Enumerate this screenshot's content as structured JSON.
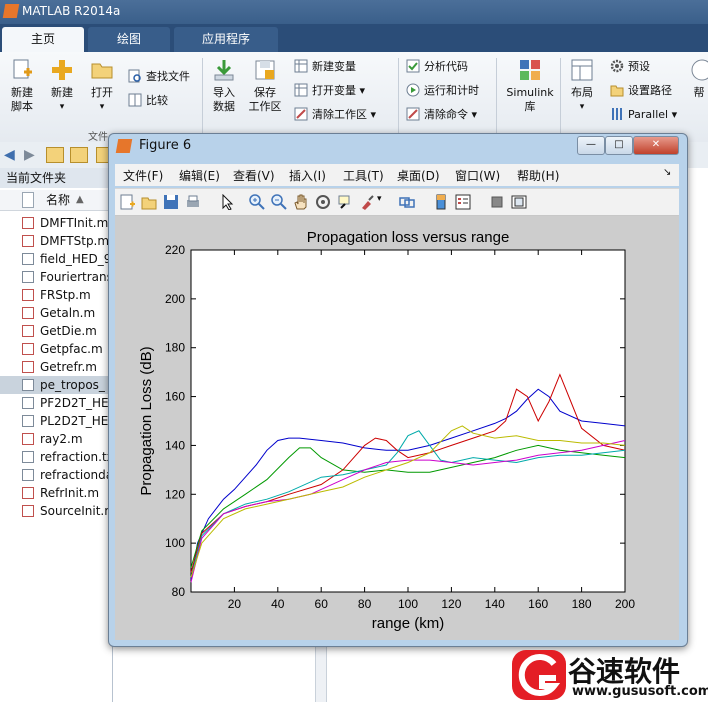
{
  "app": {
    "title": "MATLAB R2014a"
  },
  "tabs": [
    {
      "label": "主页"
    },
    {
      "label": "绘图"
    },
    {
      "label": "应用程序"
    }
  ],
  "ribbon": {
    "new_script": "新建\n脚本",
    "new": "新建",
    "open": "打开",
    "find_files": "查找文件",
    "compare": "比较",
    "import_data": "导入\n数据",
    "save_workspace": "保存\n工作区",
    "new_variable": "新建变量",
    "open_variable": "打开变量",
    "clear_workspace": "清除工作区",
    "analyze_code": "分析代码",
    "run_and_time": "运行和计时",
    "clear_commands": "清除命令",
    "simulink": "Simulink\n库",
    "layout": "布局",
    "preferences": "预设",
    "set_path": "设置路径",
    "parallel": "Parallel",
    "help": "帮",
    "file_group": "文件"
  },
  "file_panel": {
    "title": "当前文件夹",
    "col_name": "名称",
    "files": [
      "DMFTInit.m",
      "DMFTStp.m",
      "field_HED_9",
      "Fouriertrans",
      "FRStp.m",
      "Getaln.m",
      "GetDie.m",
      "Getpfac.m",
      "Getrefr.m",
      "pe_tropos_",
      "PF2D2T_HEI",
      "PL2D2T_HEI",
      "ray2.m",
      "refraction.tx",
      "refractionda",
      "RefrInit.m",
      "SourceInit.m"
    ],
    "selected_index": 9
  },
  "figure": {
    "title": "Figure 6",
    "menu": [
      "文件(F)",
      "编辑(E)",
      "查看(V)",
      "插入(I)",
      "工具(T)",
      "桌面(D)",
      "窗口(W)",
      "帮助(H)"
    ],
    "min_btn": "—",
    "max_btn": "□",
    "close_btn": "✕"
  },
  "chart_data": {
    "type": "line",
    "title": "Propagation loss versus range",
    "xlabel": "range (km)",
    "ylabel": "Propagation Loss (dB)",
    "xlim": [
      0,
      200
    ],
    "ylim": [
      80,
      220
    ],
    "xticks": [
      20,
      40,
      60,
      80,
      100,
      120,
      140,
      160,
      180,
      200
    ],
    "yticks": [
      80,
      100,
      120,
      140,
      160,
      180,
      200,
      220
    ],
    "series": [
      {
        "color": "#0000cc",
        "x": [
          0,
          3,
          8,
          15,
          20,
          25,
          30,
          35,
          40,
          45,
          50,
          60,
          70,
          80,
          90,
          100,
          110,
          120,
          130,
          140,
          145,
          150,
          155,
          160,
          165,
          170,
          180,
          190,
          200
        ],
        "y": [
          85,
          100,
          110,
          118,
          122,
          127,
          132,
          138,
          142,
          143,
          143,
          142,
          141,
          139,
          138,
          138,
          140,
          143,
          146,
          149,
          151,
          154,
          159,
          163,
          160,
          154,
          150,
          149,
          148
        ]
      },
      {
        "color": "#009900",
        "x": [
          0,
          5,
          15,
          25,
          35,
          45,
          50,
          55,
          60,
          70,
          80,
          90,
          100,
          110,
          120,
          130,
          140,
          150,
          160,
          170,
          180,
          190,
          200
        ],
        "y": [
          90,
          105,
          114,
          120,
          126,
          135,
          139,
          139,
          135,
          130,
          129,
          130,
          129,
          129,
          131,
          133,
          135,
          138,
          140,
          138,
          137,
          136,
          135
        ]
      },
      {
        "color": "#cc0000",
        "x": [
          0,
          5,
          15,
          25,
          35,
          45,
          60,
          70,
          80,
          85,
          90,
          95,
          100,
          110,
          120,
          130,
          140,
          145,
          150,
          155,
          160,
          165,
          170,
          175,
          180,
          190,
          200
        ],
        "y": [
          88,
          104,
          112,
          115,
          117,
          120,
          124,
          130,
          140,
          143,
          142,
          138,
          135,
          137,
          140,
          143,
          146,
          150,
          163,
          160,
          150,
          158,
          169,
          158,
          147,
          140,
          138
        ]
      },
      {
        "color": "#00aaaa",
        "x": [
          0,
          5,
          15,
          25,
          35,
          45,
          60,
          70,
          80,
          90,
          95,
          100,
          105,
          110,
          115,
          120,
          130,
          140,
          150,
          160,
          170,
          180,
          190,
          200
        ],
        "y": [
          86,
          103,
          112,
          116,
          118,
          121,
          127,
          128,
          130,
          132,
          137,
          144,
          146,
          140,
          134,
          133,
          135,
          134,
          133,
          135,
          136,
          136,
          137,
          138
        ]
      },
      {
        "color": "#cc00cc",
        "x": [
          0,
          5,
          15,
          25,
          35,
          45,
          55,
          60,
          70,
          80,
          90,
          100,
          110,
          120,
          130,
          140,
          150,
          160,
          170,
          180,
          190,
          200
        ],
        "y": [
          84,
          102,
          112,
          115,
          117,
          118,
          120,
          122,
          126,
          130,
          133,
          134,
          134,
          133,
          132,
          133,
          134,
          136,
          137,
          138,
          140,
          142
        ]
      },
      {
        "color": "#bbbb00",
        "x": [
          0,
          5,
          15,
          25,
          35,
          45,
          60,
          70,
          80,
          90,
          100,
          110,
          120,
          125,
          130,
          140,
          150,
          160,
          170,
          180,
          190,
          200
        ],
        "y": [
          86,
          100,
          110,
          114,
          116,
          118,
          121,
          123,
          127,
          130,
          133,
          137,
          146,
          148,
          145,
          143,
          144,
          142,
          142,
          141,
          141,
          140
        ]
      }
    ]
  },
  "watermark": {
    "brand": "谷速软件",
    "url": "www.gususoft.com",
    "logo_letter": "G"
  }
}
